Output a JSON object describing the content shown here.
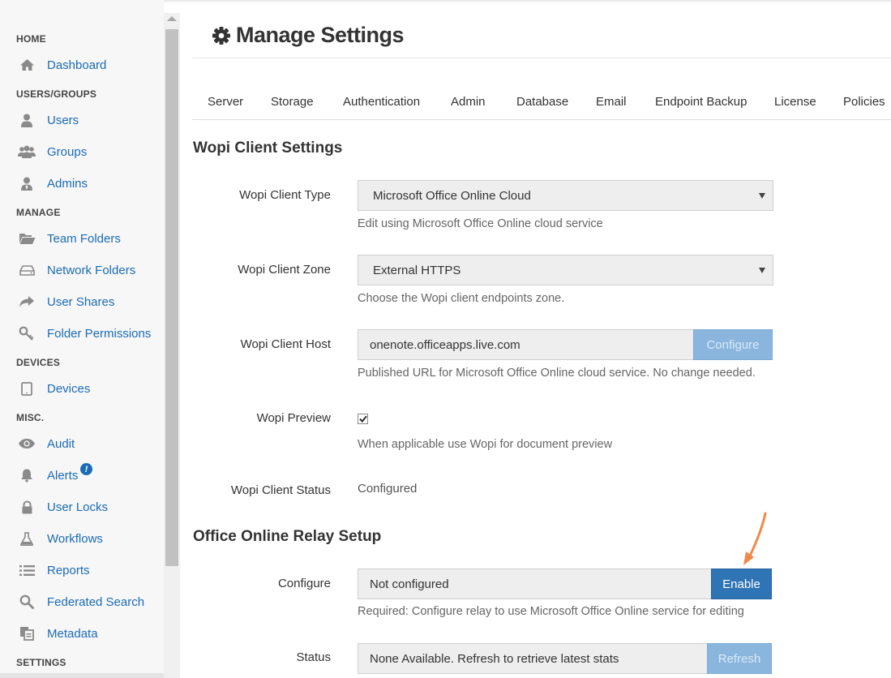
{
  "sidebar": {
    "sections": {
      "home": "HOME",
      "users_groups": "USERS/GROUPS",
      "manage": "MANAGE",
      "devices": "DEVICES",
      "misc": "MISC.",
      "settings": "SETTINGS"
    },
    "items": [
      {
        "label": "Dashboard",
        "icon": "home-icon"
      },
      {
        "label": "Users",
        "icon": "user-icon"
      },
      {
        "label": "Groups",
        "icon": "group-icon"
      },
      {
        "label": "Admins",
        "icon": "admin-icon"
      },
      {
        "label": "Team Folders",
        "icon": "folder-open-icon"
      },
      {
        "label": "Network Folders",
        "icon": "hard-drive-icon"
      },
      {
        "label": "User Shares",
        "icon": "share-icon"
      },
      {
        "label": "Folder Permissions",
        "icon": "key-icon"
      },
      {
        "label": "Devices",
        "icon": "tablet-icon"
      },
      {
        "label": "Audit",
        "icon": "eye-icon"
      },
      {
        "label": "Alerts",
        "icon": "bell-icon",
        "badge": "!"
      },
      {
        "label": "User Locks",
        "icon": "lock-icon"
      },
      {
        "label": "Workflows",
        "icon": "flask-icon"
      },
      {
        "label": "Reports",
        "icon": "list-icon"
      },
      {
        "label": "Federated Search",
        "icon": "search-icon"
      },
      {
        "label": "Metadata",
        "icon": "copy-icon"
      }
    ]
  },
  "header": {
    "title": "Manage Settings",
    "icon": "gear-icon"
  },
  "tabs": [
    "Server",
    "Storage",
    "Authentication",
    "Admin",
    "Database",
    "Email",
    "Endpoint Backup",
    "License",
    "Policies"
  ],
  "wopi": {
    "section_title": "Wopi Client Settings",
    "client_type_label": "Wopi Client Type",
    "client_type_value": "Microsoft Office Online Cloud",
    "client_type_help": "Edit using Microsoft Office Online cloud service",
    "client_zone_label": "Wopi Client Zone",
    "client_zone_value": "External HTTPS",
    "client_zone_help": "Choose the Wopi client endpoints zone.",
    "client_host_label": "Wopi Client Host",
    "client_host_value": "onenote.officeapps.live.com",
    "client_host_button": "Configure",
    "client_host_help": "Published URL for Microsoft Office Online cloud service. No change needed.",
    "preview_label": "Wopi Preview",
    "preview_checked": true,
    "preview_help": "When applicable use Wopi for document preview",
    "status_label": "Wopi Client Status",
    "status_value": "Configured"
  },
  "relay": {
    "section_title": "Office Online Relay Setup",
    "configure_label": "Configure",
    "configure_value": "Not configured",
    "enable_button": "Enable",
    "configure_help": "Required: Configure relay to use Microsoft Office Online service for editing",
    "status_label": "Status",
    "status_value": "None Available. Refresh to retrieve latest stats",
    "refresh_button": "Refresh"
  },
  "colors": {
    "link": "#1b6bb5",
    "primary": "#2f74b5",
    "disabled_button": "#8ab6de",
    "annotation_arrow": "#f0884a"
  }
}
